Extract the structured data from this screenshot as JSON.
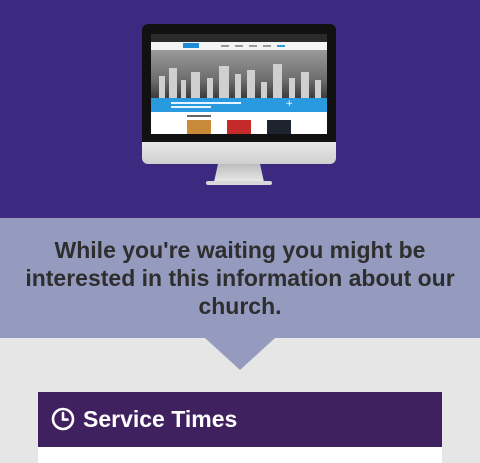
{
  "hero": {
    "background_color": "#3b2a80",
    "device_image": "imac-website-preview"
  },
  "message": {
    "text": "While you're waiting you might be interested in this information about our church.",
    "background_color": "#949bbf"
  },
  "service_times": {
    "icon": "clock-icon",
    "title": "Service Times",
    "header_color": "#3f2160"
  }
}
